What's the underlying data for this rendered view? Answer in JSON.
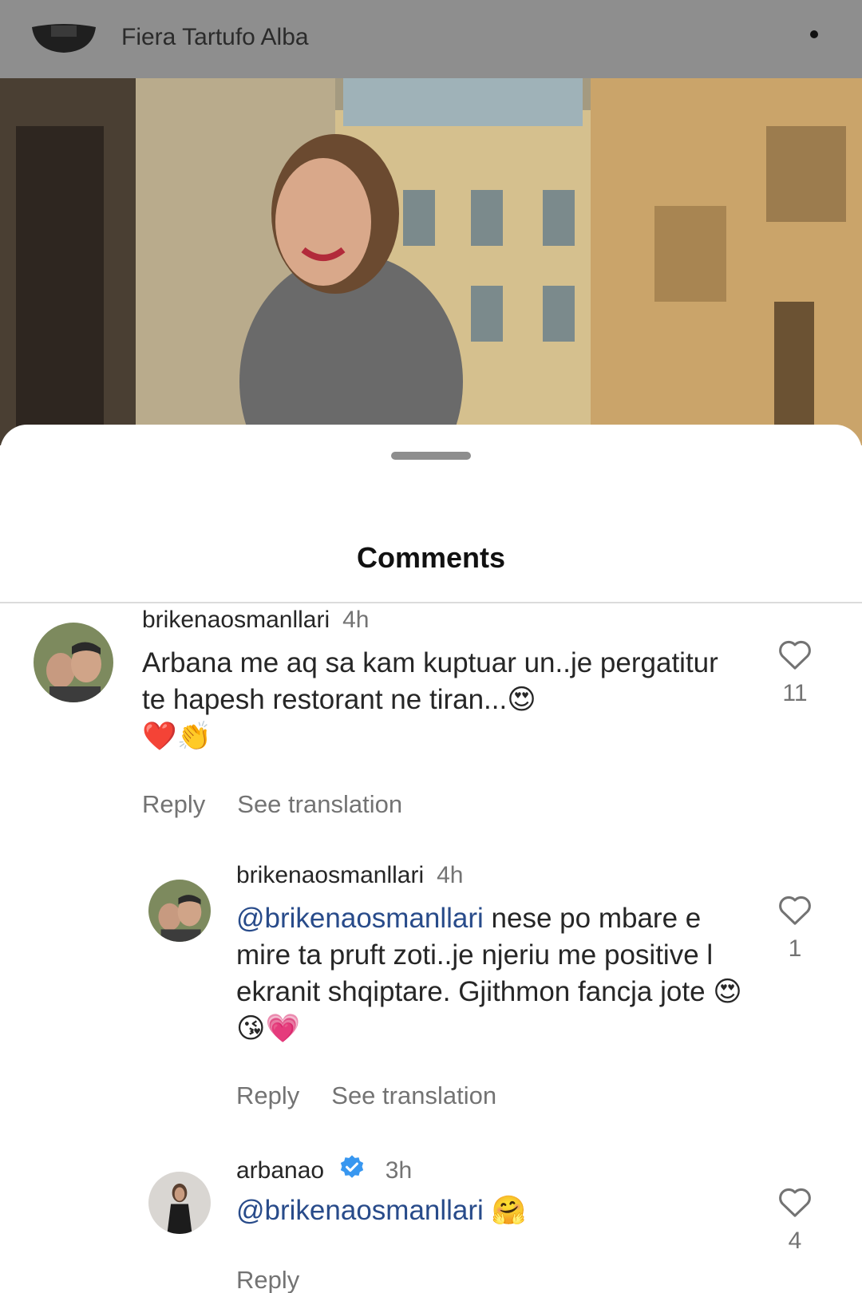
{
  "topbar": {
    "title": "Fiera Tartufo Alba"
  },
  "sheet": {
    "title": "Comments"
  },
  "comments": [
    {
      "username": "brikenaosmanllari",
      "time": "4h",
      "text": "Arbana  me aq sa kam  kuptuar  un..je pergatitur  te hapesh restorant  ne tiran...",
      "emojis_inline": "😍",
      "emojis_line2": "❤️👏",
      "likes": "11",
      "reply_label": "Reply",
      "translate_label": "See translation"
    },
    {
      "username": "brikenaosmanllari",
      "time": "4h",
      "mention": "@brikenaosmanllari",
      "text": " nese po mbare e mire ta pruft  zoti..je njeriu  me positive  l ekranit  shqiptare. Gjithmon  fancja  jote ",
      "emojis": "😍😘💗",
      "likes": "1",
      "reply_label": "Reply",
      "translate_label": "See translation"
    },
    {
      "username": "arbanao",
      "time": "3h",
      "mention": "@brikenaosmanllari",
      "emojis": "🤗",
      "likes": "4",
      "reply_label": "Reply"
    }
  ],
  "colors": {
    "mention": "#284b8a",
    "verified": "#3897f0",
    "muted": "#737373"
  }
}
